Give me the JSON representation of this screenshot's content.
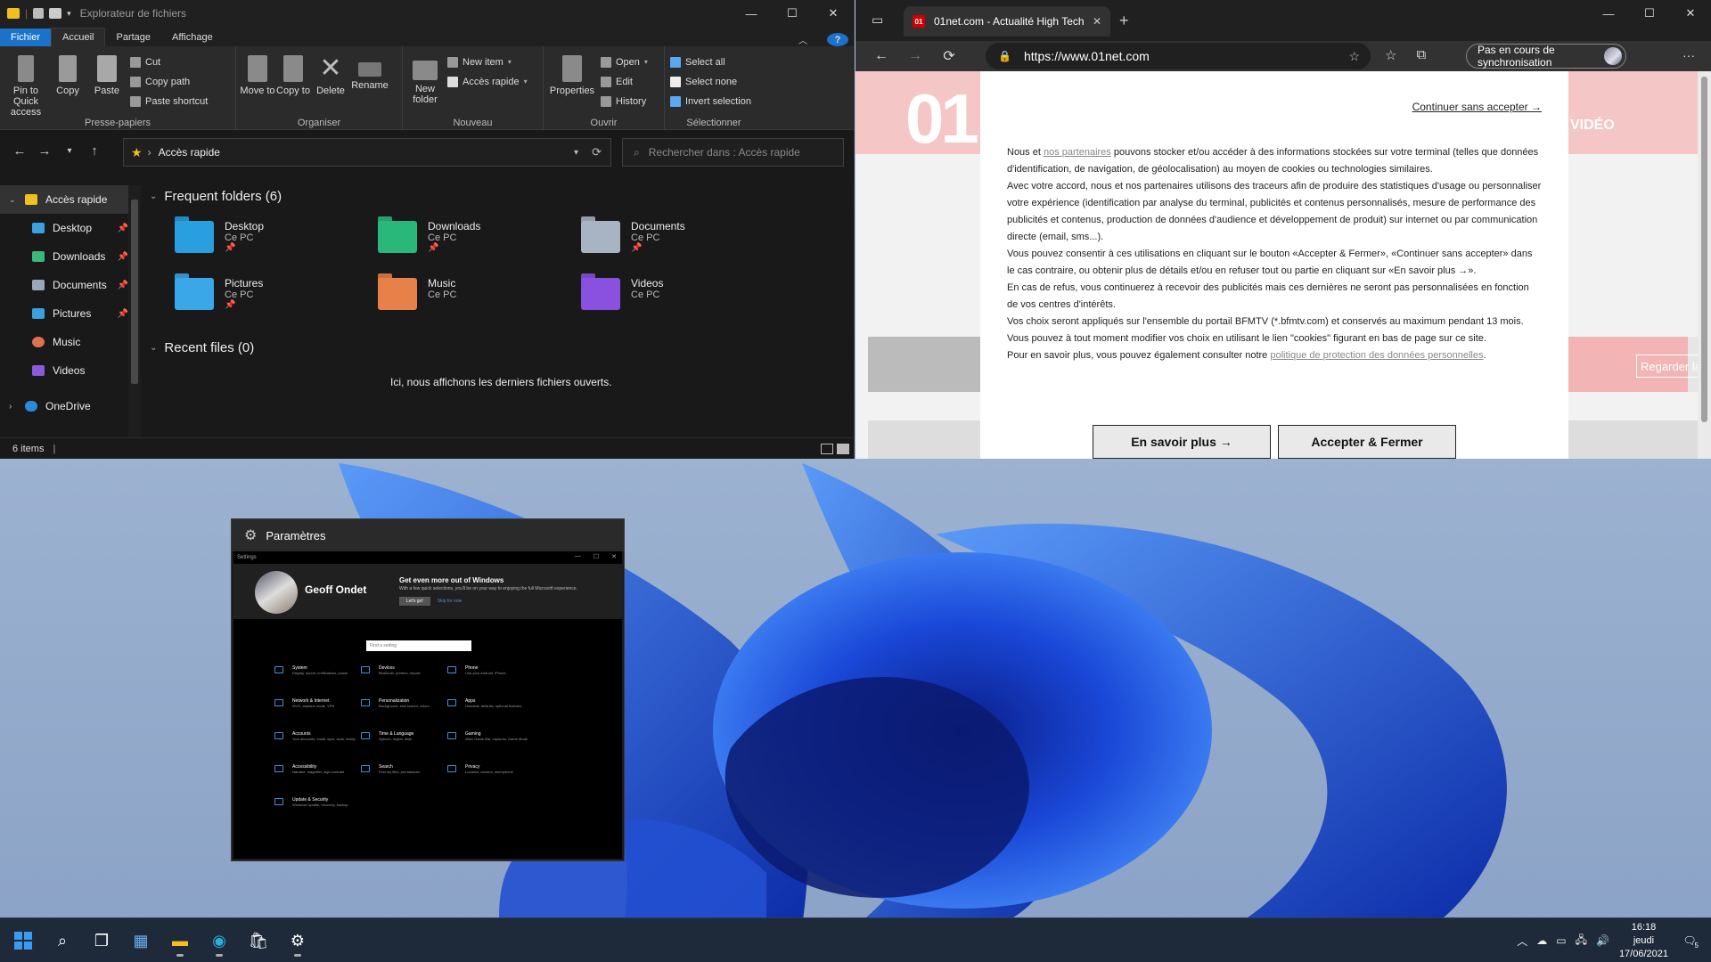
{
  "explorer": {
    "title": "Explorateur de fichiers",
    "tabs": [
      "Fichier",
      "Accueil",
      "Partage",
      "Affichage"
    ],
    "help": "?",
    "ribbon": {
      "clipboard": {
        "pin": "Pin to Quick access",
        "copy": "Copy",
        "paste": "Paste",
        "cut": "Cut",
        "copy_path": "Copy path",
        "paste_shortcut": "Paste shortcut",
        "label": "Presse-papiers"
      },
      "organize": {
        "move_to": "Move to",
        "copy_to": "Copy to",
        "delete": "Delete",
        "rename": "Rename",
        "label": "Organiser"
      },
      "new": {
        "new_folder": "New folder",
        "new_item": "New item",
        "easy_access": "Accès rapide",
        "label": "Nouveau"
      },
      "open": {
        "properties": "Properties",
        "open": "Open",
        "edit": "Edit",
        "history": "History",
        "label": "Ouvrir"
      },
      "select": {
        "select_all": "Select all",
        "select_none": "Select none",
        "invert": "Invert selection",
        "label": "Sélectionner"
      }
    },
    "address": "Accès rapide",
    "search_placeholder": "Rechercher dans : Accès rapide",
    "sidebar": [
      {
        "label": "Accès rapide",
        "color": "#f0c020"
      },
      {
        "label": "Desktop",
        "color": "#3aa0e0"
      },
      {
        "label": "Downloads",
        "color": "#3ab87a"
      },
      {
        "label": "Documents",
        "color": "#9aa8b8"
      },
      {
        "label": "Pictures",
        "color": "#3aa0e0"
      },
      {
        "label": "Music",
        "color": "#e07050"
      },
      {
        "label": "Videos",
        "color": "#8a5ad8"
      },
      {
        "label": "OneDrive",
        "color": "#2a8ad8"
      }
    ],
    "frequent_header": "Frequent folders (6)",
    "folders": [
      {
        "name": "Desktop",
        "sub": "Ce PC",
        "color": "#2a9fe0"
      },
      {
        "name": "Downloads",
        "sub": "Ce PC",
        "color": "#2ab87a"
      },
      {
        "name": "Documents",
        "sub": "Ce PC",
        "color": "#a8b4c4"
      },
      {
        "name": "Pictures",
        "sub": "Ce PC",
        "color": "#3aa8e8"
      },
      {
        "name": "Music",
        "sub": "Ce PC",
        "color": "#e8804a"
      },
      {
        "name": "Videos",
        "sub": "Ce PC",
        "color": "#8a50e0"
      }
    ],
    "recent_header": "Recent files (0)",
    "recent_empty": "Ici, nous affichons les derniers fichiers ouverts.",
    "status": "6 items"
  },
  "edge": {
    "tab_title": "01net.com - Actualité High Tech",
    "favicon": "01",
    "url": "https://www.01net.com",
    "sync_label": "Pas en cours de synchronisation",
    "site": {
      "logo": "01",
      "video": "VIDÉO",
      "watch": "Regarder la"
    },
    "consent": {
      "continue": "Continuer sans accepter →",
      "p1_a": "Nous et ",
      "p1_link": "nos partenaires",
      "p1_b": " pouvons stocker et/ou accéder à des informations stockées sur votre terminal (telles que données d'identification, de navigation, de géolocalisation) au moyen de cookies ou technologies similaires.",
      "p2": "Avec votre accord, nous et nos partenaires utilisons des traceurs afin de produire des statistiques d'usage ou personnaliser votre expérience (identification par analyse du terminal, publicités et contenus personnalisés, mesure de performance des publicités et contenus, production de données d'audience et développement de produit) sur internet ou par communication directe (email, sms...).",
      "p3": "Vous pouvez consentir à ces utilisations en cliquant sur le bouton «Accepter & Fermer», «Continuer sans accepter» dans le cas contraire, ou obtenir plus de détails et/ou en refuser tout ou partie en cliquant sur «En savoir plus →».",
      "p4": "En cas de refus, vous continuerez à recevoir des publicités mais ces dernières ne seront pas personnalisées en fonction de vos centres d'intérêts.",
      "p5": "Vos choix seront appliqués sur l'ensemble du portail BFMTV (*.bfmtv.com) et conservés au maximum pendant 13 mois. Vous pouvez à tout moment modifier vos choix en utilisant le lien \"cookies\" figurant en bas de page sur ce site.",
      "p6_a": "Pour en savoir plus, vous pouvez également consulter notre ",
      "p6_link": "politique de protection des données personnelles",
      "p6_b": ".",
      "learn_more": "En savoir plus →",
      "accept": "Accepter & Fermer"
    }
  },
  "settings": {
    "title": "Paramètres",
    "inner_title": "Settings",
    "user": "Geoff Ondet",
    "promo_title": "Get even more out of Windows",
    "promo_sub": "With a few quick selections, you'll be on your way to enjoying the full Microsoft experience.",
    "promo_btn": "Let's go!",
    "promo_skip": "Skip for now",
    "search_placeholder": "Find a setting",
    "categories": [
      {
        "name": "System",
        "desc": "Display, sound, notifications, power"
      },
      {
        "name": "Devices",
        "desc": "Bluetooth, printers, mouse"
      },
      {
        "name": "Phone",
        "desc": "Link your Android, iPhone"
      },
      {
        "name": "Network & Internet",
        "desc": "Wi-Fi, airplane mode, VPN"
      },
      {
        "name": "Personalization",
        "desc": "Background, lock screen, colors"
      },
      {
        "name": "Apps",
        "desc": "Uninstall, defaults, optional features"
      },
      {
        "name": "Accounts",
        "desc": "Your accounts, email, sync, work, family"
      },
      {
        "name": "Time & Language",
        "desc": "Speech, region, date"
      },
      {
        "name": "Gaming",
        "desc": "Xbox Game Bar, captures, Game Mode"
      },
      {
        "name": "Accessibility",
        "desc": "Narrator, magnifier, high contrast"
      },
      {
        "name": "Search",
        "desc": "Find my files, permissions"
      },
      {
        "name": "Privacy",
        "desc": "Location, camera, microphone"
      },
      {
        "name": "Update & Security",
        "desc": "Windows Update, recovery, backup"
      }
    ]
  },
  "taskbar": {
    "time": "16:18",
    "day": "jeudi",
    "date": "17/06/2021",
    "notif_count": "5"
  }
}
